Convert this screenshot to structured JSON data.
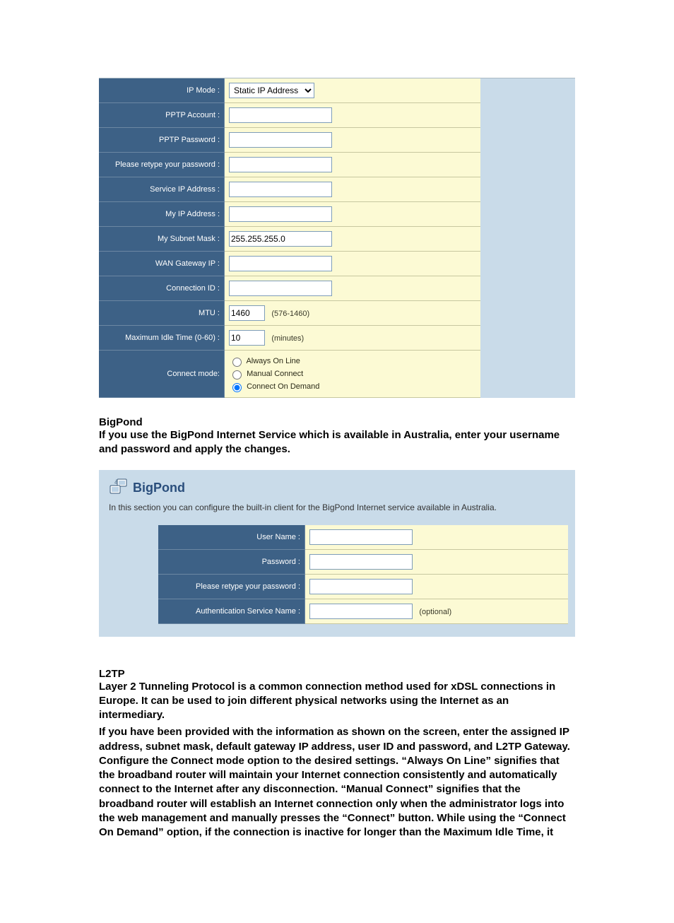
{
  "pptp": {
    "ip_mode_label": "IP Mode :",
    "ip_mode_value": "Static IP Address",
    "account_label": "PPTP Account :",
    "account_value": "",
    "password_label": "PPTP Password :",
    "password_value": "",
    "retype_label": "Please retype your password :",
    "retype_value": "",
    "service_ip_label": "Service IP Address :",
    "service_ip_value": "",
    "my_ip_label": "My IP Address :",
    "my_ip_value": "",
    "subnet_label": "My Subnet Mask :",
    "subnet_value": "255.255.255.0",
    "gateway_label": "WAN Gateway IP :",
    "gateway_value": "",
    "connid_label": "Connection ID :",
    "connid_value": "",
    "mtu_label": "MTU :",
    "mtu_value": "1460",
    "mtu_suffix": "(576-1460)",
    "idle_label": "Maximum Idle Time (0-60) :",
    "idle_value": "10",
    "idle_suffix": "(minutes)",
    "connect_mode_label": "Connect mode:",
    "connect_mode": {
      "always": "Always On Line",
      "manual": "Manual Connect",
      "demand": "Connect On Demand"
    }
  },
  "doc": {
    "bigpond_heading": "BigPond",
    "bigpond_text": "If you use the BigPond Internet Service which is available in Australia, enter your username and password and apply the changes.",
    "l2tp_heading": "L2TP",
    "l2tp_text1": "Layer 2 Tunneling Protocol is a common connection method used for xDSL connections in Europe. It can be used to join different physical networks using the Internet as an intermediary.",
    "l2tp_text2": "If you have been provided with the information as shown on the screen, enter the assigned IP address, subnet mask, default gateway IP address, user ID and password, and L2TP Gateway. Configure the Connect mode option to the desired settings. “Always On Line” signifies that the broadband router will maintain your Internet connection consistently and automatically connect to the Internet after any disconnection. “Manual Connect” signifies that the broadband router will establish an Internet connection only when the administrator logs into the web management and manually presses the “Connect” button. While using the “Connect On Demand” option, if the connection is inactive for longer than the Maximum Idle Time, it"
  },
  "bigpond": {
    "title": "BigPond",
    "desc": "In this section you can configure the built-in client for the BigPond Internet service available in Australia.",
    "user_label": "User Name :",
    "user_value": "",
    "password_label": "Password :",
    "password_value": "",
    "retype_label": "Please retype your password :",
    "retype_value": "",
    "auth_label": "Authentication Service Name :",
    "auth_value": "",
    "optional": "(optional)"
  }
}
